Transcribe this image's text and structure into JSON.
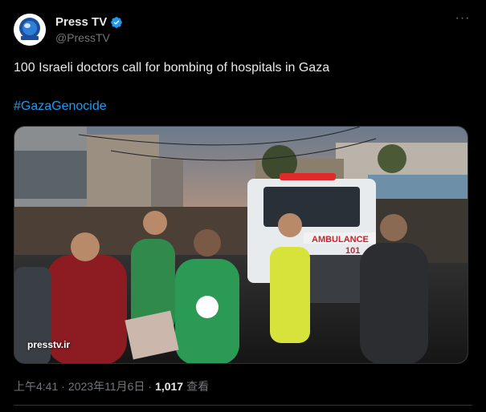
{
  "author": {
    "display_name": "Press TV",
    "handle": "@PressTV",
    "avatar_icon": "presstv-globe-logo-icon",
    "verified_icon": "verified-badge-icon",
    "verified_color": "#1d9bf0"
  },
  "more_icon": "more-dots-icon",
  "tweet": {
    "text": "100 Israeli doctors call for bombing of hospitals in Gaza",
    "hashtag": "#GazaGenocide"
  },
  "media": {
    "watermark": "presstv.ir",
    "ambulance_label": "AMBULANCE",
    "ambulance_number": "101"
  },
  "meta": {
    "time": "上午4:41",
    "separator": "·",
    "date": "2023年11月6日",
    "views_count": "1,017",
    "views_label": "查看"
  },
  "colors": {
    "background": "#000000",
    "text": "#e7e9ea",
    "secondary": "#71767b",
    "link": "#1d9bf0"
  }
}
